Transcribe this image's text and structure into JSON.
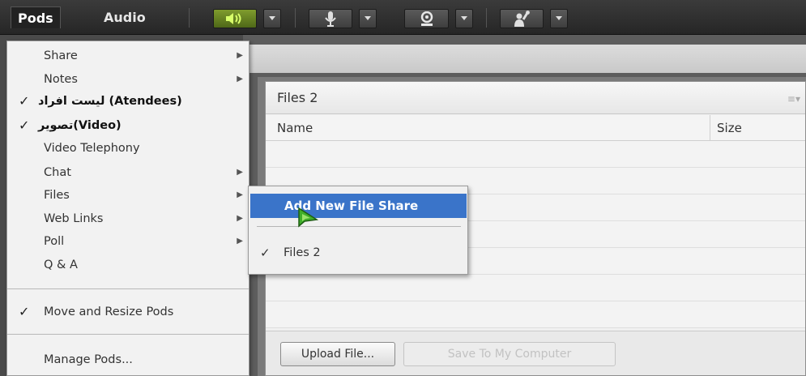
{
  "menubar": {
    "pods_label": "Pods",
    "audio_label": "Audio"
  },
  "toolbar": {
    "buttons": [
      {
        "icon": "speaker-icon"
      },
      {
        "icon": "microphone-icon"
      },
      {
        "icon": "webcam-icon"
      },
      {
        "icon": "raise-hand-icon"
      }
    ]
  },
  "pods_menu": {
    "items": [
      {
        "label": "Share",
        "checked": false,
        "submenu": true
      },
      {
        "label": "Notes",
        "checked": false,
        "submenu": true
      },
      {
        "label": "ليست افراد (Atendees)",
        "checked": true,
        "submenu": false
      },
      {
        "label": "تصوير(Video)",
        "checked": true,
        "submenu": false
      },
      {
        "label": "Video Telephony",
        "checked": false,
        "submenu": false
      },
      {
        "label": "Chat",
        "checked": false,
        "submenu": true
      },
      {
        "label": "Files",
        "checked": false,
        "submenu": true
      },
      {
        "label": "Web Links",
        "checked": false,
        "submenu": true
      },
      {
        "label": "Poll",
        "checked": false,
        "submenu": true
      },
      {
        "label": "Q & A",
        "checked": false,
        "submenu": false
      }
    ],
    "move_resize_label": "Move and Resize Pods",
    "manage_label": "Manage Pods..."
  },
  "files_submenu": {
    "add_label": "Add New File Share",
    "files_item_label": "Files 2"
  },
  "files_pod": {
    "title": "Files 2",
    "columns": {
      "name": "Name",
      "size": "Size"
    },
    "upload_label": "Upload File...",
    "save_label": "Save To My Computer"
  },
  "colors": {
    "highlight": "#3a74c9",
    "speaker_active": "#6f8c24"
  }
}
